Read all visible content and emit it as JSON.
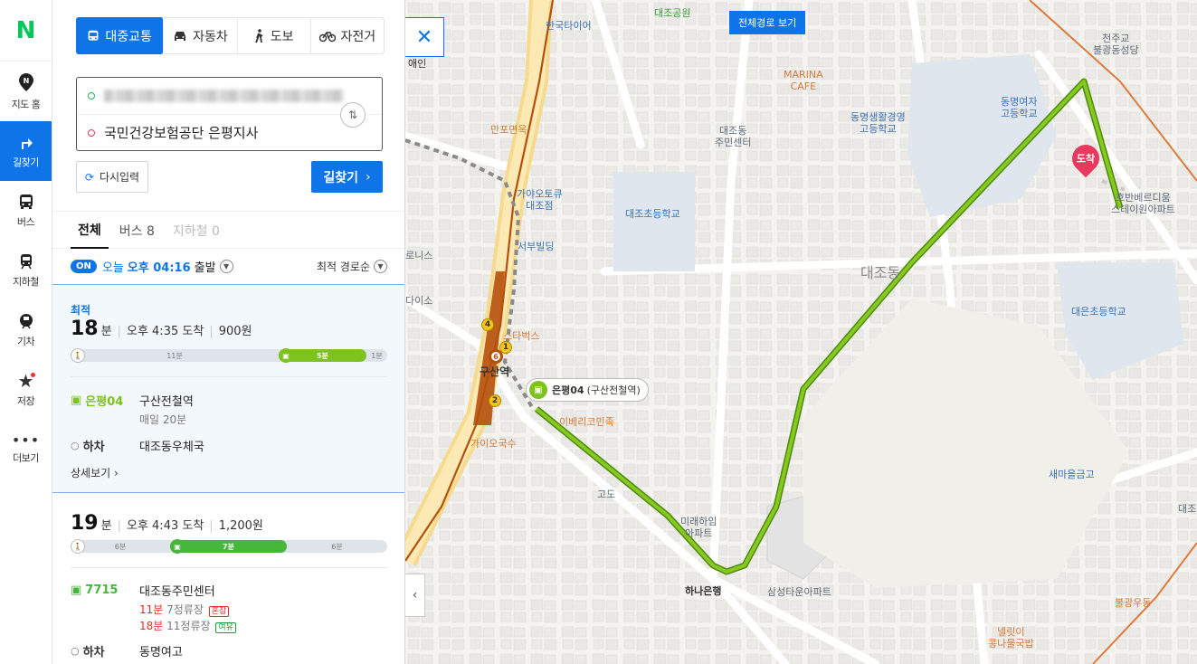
{
  "nav": {
    "logo": "N",
    "items": [
      {
        "label": "지도 홈",
        "icon": "map-home-icon"
      },
      {
        "label": "길찾기",
        "icon": "directions-icon",
        "active": true
      },
      {
        "label": "버스",
        "icon": "bus-icon"
      },
      {
        "label": "지하철",
        "icon": "subway-icon"
      },
      {
        "label": "기차",
        "icon": "train-icon"
      },
      {
        "label": "저장",
        "icon": "star-icon"
      },
      {
        "label": "더보기",
        "icon": "more-icon"
      }
    ]
  },
  "modes": [
    "대중교통",
    "자동차",
    "도보",
    "자전거"
  ],
  "route": {
    "destination": "국민건강보험공단 은평지사"
  },
  "buttons": {
    "reset": "다시입력",
    "search": "길찾기"
  },
  "tabs": {
    "all": "전체",
    "bus": "버스 8",
    "subway": "지하철 0"
  },
  "depart": {
    "on": "ON",
    "day": "오늘",
    "time": "오후 04:16",
    "suffix": "출발",
    "sort": "최적 경로순"
  },
  "results": [
    {
      "badge": "최적",
      "minutes": "18",
      "unit": "분",
      "arrive": "오후 4:35 도착",
      "fare": "900원",
      "bar": [
        {
          "label": "11분",
          "type": "walk",
          "fraction": 0.658
        },
        {
          "label": "5분",
          "type": "bus",
          "fraction": 0.277
        },
        {
          "label": "1분",
          "type": "walk",
          "fraction": 0.065
        }
      ],
      "board_route": "은평04",
      "board_stop": "구산전철역",
      "interval": "매일 20분",
      "off_label": "하차",
      "off_stop": "대조동우체국",
      "detail": "상세보기"
    },
    {
      "minutes": "19",
      "unit": "분",
      "arrive": "오후 4:43 도착",
      "fare": "1,200원",
      "bar": [
        {
          "label": "6분",
          "type": "walk",
          "fraction": 0.315
        },
        {
          "label": "7분",
          "type": "bus",
          "fraction": 0.368
        },
        {
          "label": "6분",
          "type": "walk",
          "fraction": 0.317
        }
      ],
      "board_route": "7715",
      "board_stop": "대조동주민센터",
      "eta1_min": "11분",
      "eta1_stops": "7정류장",
      "eta1_status": "혼잡",
      "eta2_min": "18분",
      "eta2_stops": "11정류장",
      "eta2_status": "여유",
      "off_label": "하차",
      "off_stop": "동명여고"
    }
  ],
  "map": {
    "full_route": "전체경로 보기",
    "callout_route": "은평04",
    "callout_stop": "(구산전철역)",
    "arrive": "도착",
    "labels": {
      "hankook": "한국타이어",
      "daejo_park": "대조공원",
      "marina": "MARINA\nCAFE",
      "cheonju": "천주교\n불광동성당",
      "dongmyeong_girls": "동명여자\n고등학교",
      "dongmyeong_life": "동명생활경영\n고등학교",
      "daejo_center": "대조동\n주민센터",
      "manpo": "만포면옥",
      "gaya": "가야오토큐\n대조점",
      "daejo_elem": "대조초등학교",
      "seobu": "서부빌딩",
      "hobangi": "호반베르디움\n스테이원아파트",
      "daejo_dong": "대조동",
      "daeeun": "대은초등학교",
      "starbucks": "스타벅스",
      "gusan": "구산역",
      "iberico": "이베리코민족",
      "gaio": "가이오국수",
      "godo": "고도",
      "saemaul": "새마을금고",
      "mirae": "미래하임\n아파트",
      "hana": "하나은행",
      "samsung": "삼성타운아파트",
      "bulgwang": "불광우동",
      "nellit": "넬릿이\n콩나물국밥",
      "aein": "애인",
      "roni": "로니스",
      "daiso": "다이소",
      "daejo_edge": "대조"
    }
  },
  "colors": {
    "accent": "#0e74e8",
    "bus_green": "#7dc21e",
    "bus_green2": "#45b83b",
    "destination": "#e8395e",
    "subway": "#b5500b"
  }
}
